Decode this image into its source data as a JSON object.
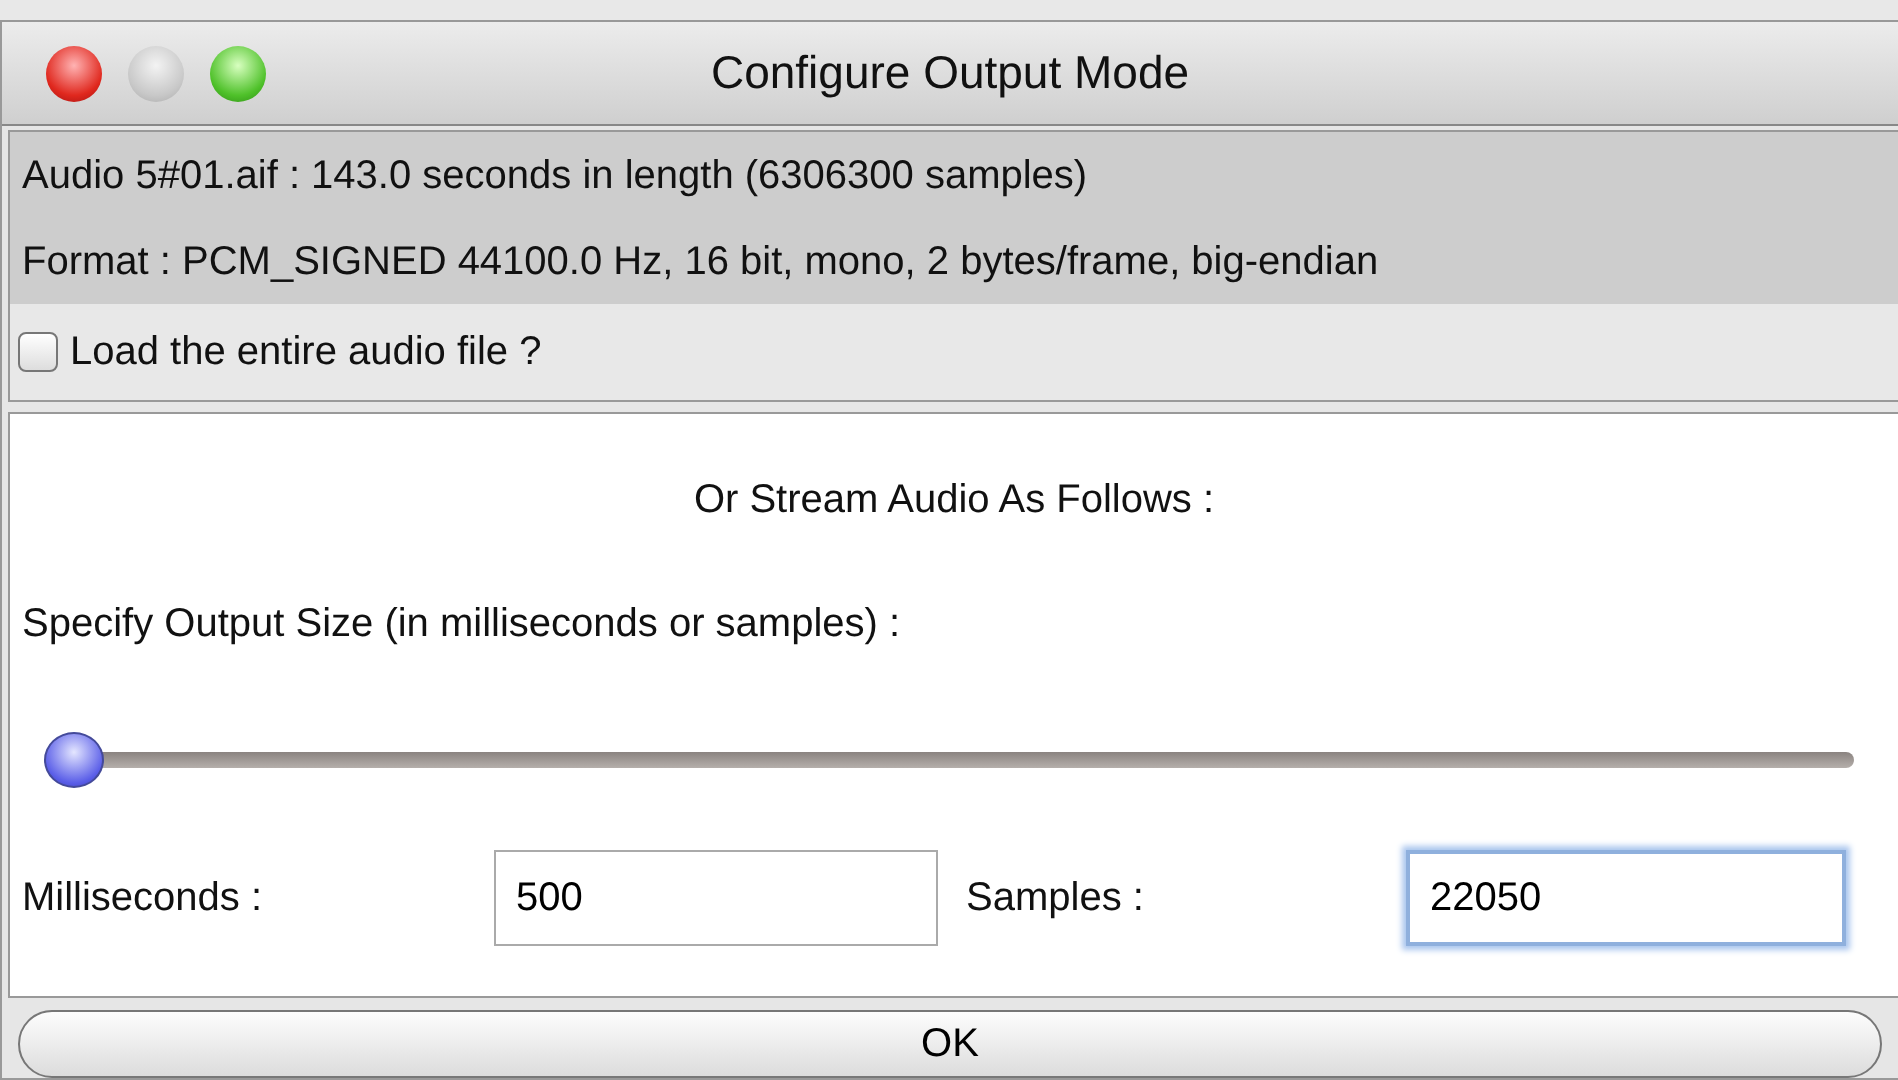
{
  "window": {
    "title": "Configure Output Mode"
  },
  "info": [
    "Audio 5#01.aif : 143.0 seconds in length (6306300 samples)",
    "Format : PCM_SIGNED 44100.0 Hz, 16 bit, mono, 2 bytes/frame, big-endian"
  ],
  "load_checkbox": {
    "label": "Load the entire audio file ?",
    "checked": false
  },
  "stream_heading": "Or Stream Audio As Follows :",
  "size_label": "Specify Output Size (in milliseconds or samples) :",
  "slider": {
    "level": 0
  },
  "fields": [
    {
      "label": "Milliseconds :",
      "value": "500",
      "focused": false
    },
    {
      "label": "Samples :",
      "value": "22050",
      "focused": true
    }
  ],
  "buttons": [
    "OK"
  ]
}
